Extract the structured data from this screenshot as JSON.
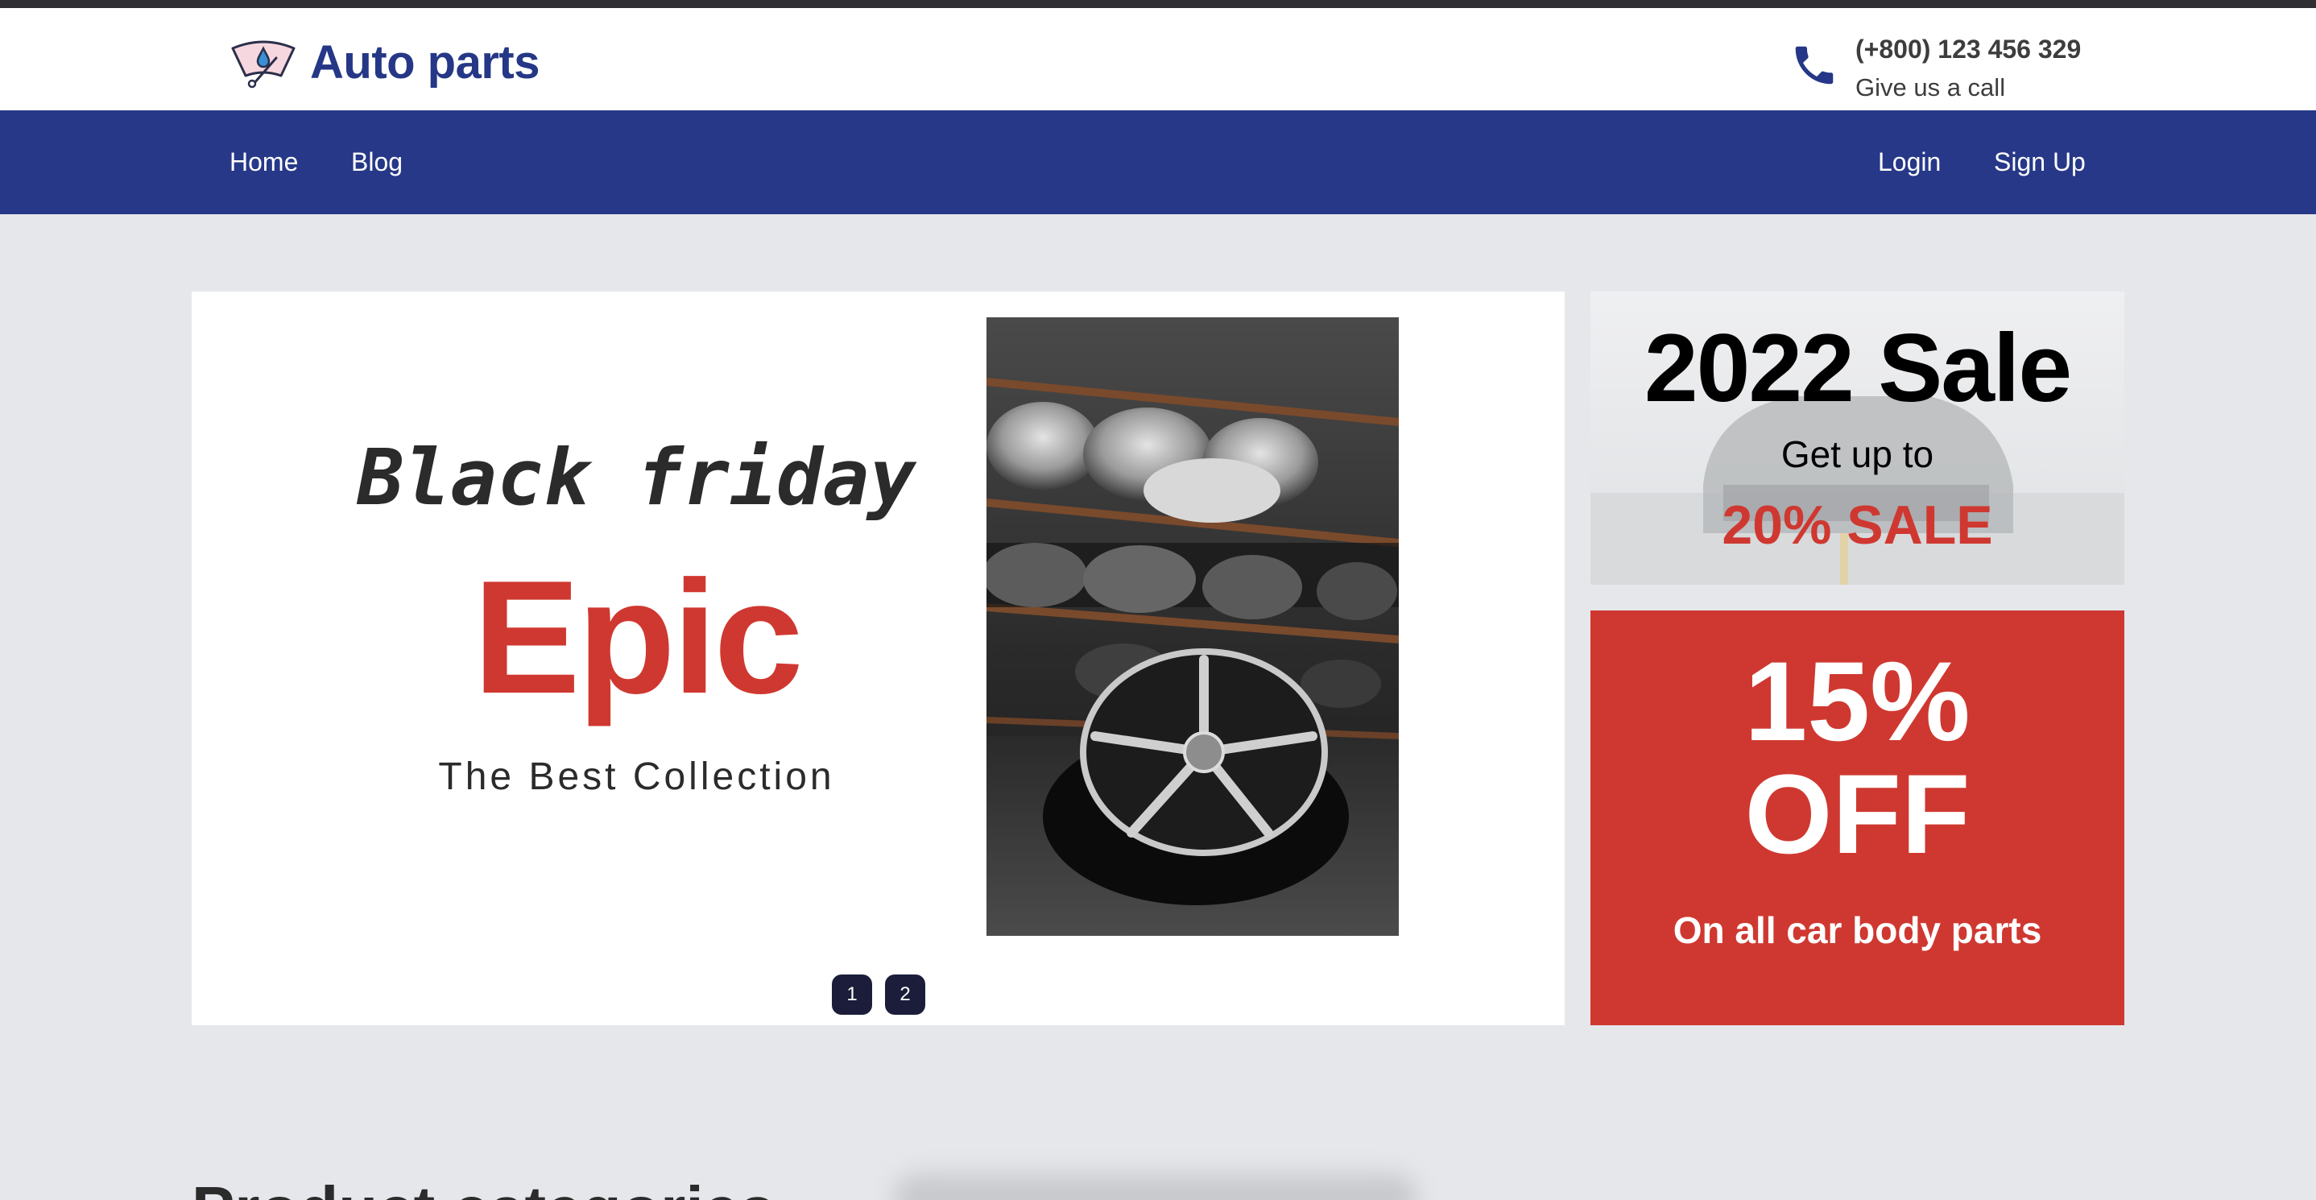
{
  "brand": {
    "name": "Auto parts",
    "icon": "windshield-wiper-icon",
    "color": "#253786"
  },
  "contact": {
    "phone": "(+800) 123 456 329",
    "subtitle": "Give us a call",
    "icon": "phone-icon"
  },
  "nav": {
    "left": [
      {
        "label": "Home"
      },
      {
        "label": "Blog"
      }
    ],
    "right": [
      {
        "label": "Login"
      },
      {
        "label": "Sign Up"
      }
    ],
    "background": "#263887"
  },
  "hero": {
    "line1": "Black friday",
    "headline": "Epic",
    "tagline": "The Best Collection",
    "image": "alloy-wheels-shelf-photo",
    "pagination": [
      "1",
      "2"
    ],
    "accent": "#cf3830"
  },
  "promo_sale": {
    "title": "2022 Sale",
    "subtitle": "Get up to",
    "highlight": "20% SALE",
    "image": "sports-car-photo"
  },
  "promo_discount": {
    "percent": "15%",
    "label": "OFF",
    "subtitle": "On all car body parts",
    "background": "#cf3830"
  },
  "section": {
    "title": "Product categories"
  }
}
